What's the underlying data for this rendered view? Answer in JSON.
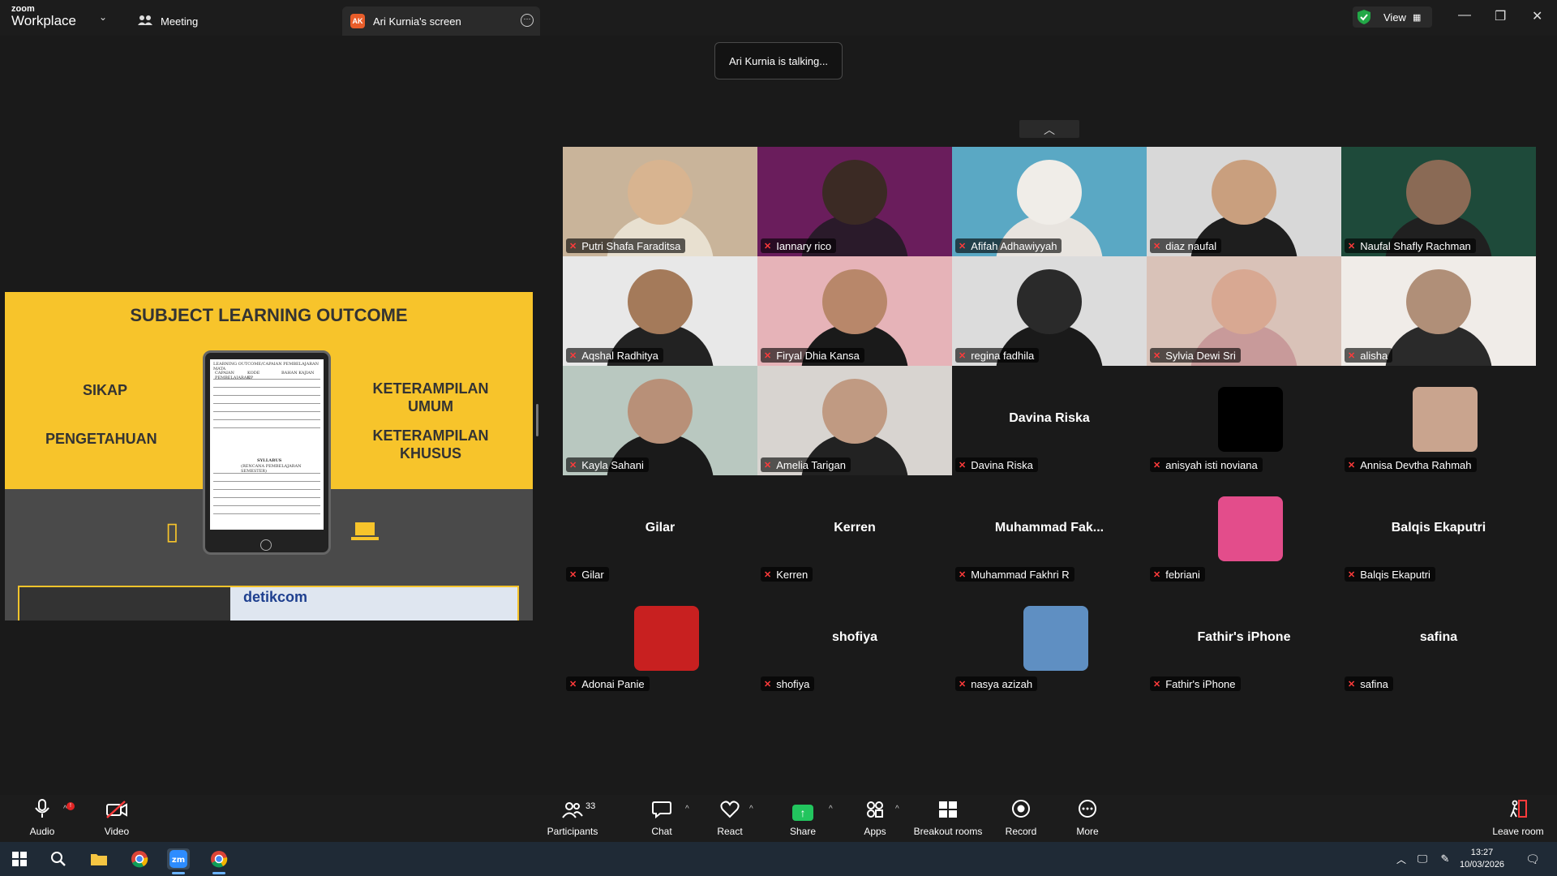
{
  "app": {
    "logo_top": "zoom",
    "logo_bottom": "Workplace",
    "tab_meeting": "Meeting",
    "tab_screen": "Ari Kurnia's screen",
    "tab_screen_badge": "AK",
    "view_label": "View"
  },
  "talking_indicator": "Ari Kurnia is talking...",
  "shared_slide": {
    "title": "SUBJECT LEARNING OUTCOME",
    "left_items": [
      "SIKAP",
      "PENGETAHUAN"
    ],
    "right_items": [
      "KETERAMPILAN UMUM",
      "KETERAMPILAN KHUSUS"
    ],
    "doc_header": "LEARNING OUTCOME/CAPAIAN PEMBELAJARAN MATA",
    "doc_col_1": "CAPAIAN PEMBELAJARAN",
    "doc_col_2": "KODE CP",
    "doc_col_3": "BAHAN KAJIAN",
    "doc_syllabus": "SYLLABUS",
    "doc_syllabus_sub": "(RENCANA PEMBELAJARAN SEMESTER)",
    "news_text": "detikcom"
  },
  "participants": [
    {
      "name": "Putri Shafa Faraditsa",
      "type": "video",
      "bg": "#c9b49a",
      "skin": "#d8b490",
      "cloth": "#e8e0d0"
    },
    {
      "name": "Iannary rico",
      "type": "video",
      "bg": "#6a1d5c",
      "skin": "#3b2a24",
      "cloth": "#2a1a2a"
    },
    {
      "name": "Afifah Adhawiyyah",
      "type": "video",
      "bg": "#5aa8c4",
      "skin": "#f0ede8",
      "cloth": "#e8e4df"
    },
    {
      "name": "diaz naufal",
      "type": "video",
      "bg": "#d8d8d8",
      "skin": "#c99f7e",
      "cloth": "#1e1e1e"
    },
    {
      "name": "Naufal Shafly Rachman",
      "type": "video",
      "bg": "#1e4a3a",
      "skin": "#8a6a55",
      "cloth": "#202020"
    },
    {
      "name": "Aqshal Radhitya",
      "type": "video",
      "bg": "#e8e8e8",
      "skin": "#a47a5a",
      "cloth": "#222"
    },
    {
      "name": "Firyal Dhia Kansa",
      "type": "video",
      "bg": "#e6b3b8",
      "skin": "#b8876a",
      "cloth": "#1a1a1a"
    },
    {
      "name": "regina fadhila",
      "type": "video",
      "bg": "#dcdcdc",
      "skin": "#2a2a2a",
      "cloth": "#1a1a1a"
    },
    {
      "name": "Sylvia Dewi Sri",
      "type": "video",
      "bg": "#d9c2b8",
      "skin": "#d8a892",
      "cloth": "#c89a9a"
    },
    {
      "name": "alisha",
      "type": "video",
      "bg": "#f0ece8",
      "skin": "#b08f78",
      "cloth": "#2a2a2a"
    },
    {
      "name": "Kayla Sahani",
      "type": "video",
      "bg": "#b9c8c0",
      "skin": "#b89078",
      "cloth": "#1a1a1a"
    },
    {
      "name": "Amelia Tarigan",
      "type": "video",
      "bg": "#d8d4d0",
      "skin": "#c09a82",
      "cloth": "#222"
    },
    {
      "name": "Davina Riska",
      "type": "name",
      "big": "Davina Riska"
    },
    {
      "name": "anisyah isti noviana",
      "type": "avatar",
      "avatar_color": "#000000"
    },
    {
      "name": "Annisa Devtha Rahmah",
      "type": "avatar",
      "avatar_color": "#c9a48e"
    },
    {
      "name": "Gilar",
      "type": "name",
      "big": "Gilar"
    },
    {
      "name": "Kerren",
      "type": "name",
      "big": "Kerren"
    },
    {
      "name": "Muhammad Fakhri R",
      "type": "name",
      "big": "Muhammad  Fak..."
    },
    {
      "name": "febriani",
      "type": "avatar",
      "avatar_color": "#e34d8b"
    },
    {
      "name": "Balqis Ekaputri",
      "type": "name",
      "big": "Balqis Ekaputri"
    },
    {
      "name": "Adonai Panie",
      "type": "avatar",
      "avatar_color": "#c82020"
    },
    {
      "name": "shofiya",
      "type": "name",
      "big": "shofiya"
    },
    {
      "name": "nasya azizah",
      "type": "avatar",
      "avatar_color": "#5f8fc2"
    },
    {
      "name": "Fathir's iPhone",
      "type": "name",
      "big": "Fathir's iPhone"
    },
    {
      "name": "safina",
      "type": "name",
      "big": "safina"
    }
  ],
  "toolbar": {
    "audio": "Audio",
    "video": "Video",
    "participants": "Participants",
    "participants_count": "33",
    "chat": "Chat",
    "react": "React",
    "share": "Share",
    "apps": "Apps",
    "breakout": "Breakout rooms",
    "record": "Record",
    "more": "More",
    "leave": "Leave room"
  },
  "taskbar": {
    "time": "13:27",
    "date": "10/03/2026"
  },
  "colors": {
    "slide_yellow": "#f7c42b",
    "share_green": "#22c55e",
    "mic_off_red": "#ff3b3b"
  }
}
